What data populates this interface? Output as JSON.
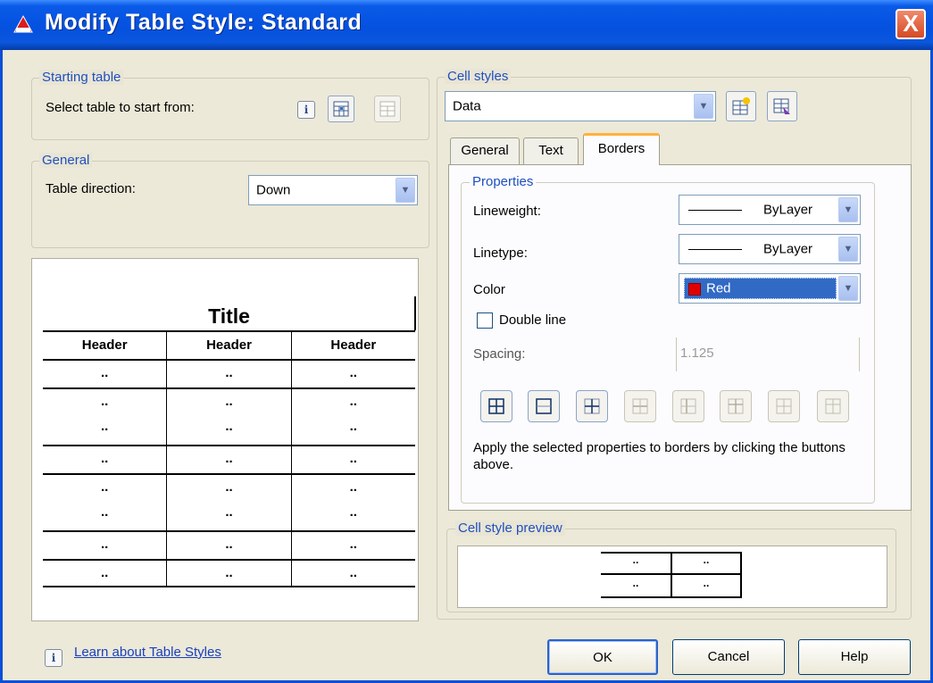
{
  "window": {
    "title": "Modify Table Style: Standard",
    "close_label": "X"
  },
  "starting_table": {
    "legend": "Starting table",
    "label": "Select table to start from:"
  },
  "general": {
    "legend": "General",
    "direction_label": "Table direction:",
    "direction_value": "Down"
  },
  "preview_table": {
    "title": "Title",
    "headers": [
      "Header",
      "Header",
      "Header"
    ],
    "rows": [
      [
        "..",
        "..",
        ".."
      ],
      [
        "..",
        "..",
        ".."
      ],
      [
        "..",
        "..",
        ".."
      ],
      [
        "..",
        "..",
        ".."
      ],
      [
        "..",
        "..",
        ".."
      ],
      [
        "..",
        "..",
        ".."
      ],
      [
        "..",
        "..",
        ".."
      ],
      [
        "..",
        "..",
        ".."
      ]
    ]
  },
  "cell_styles": {
    "legend": "Cell styles",
    "value": "Data"
  },
  "tabs": [
    "General",
    "Text",
    "Borders"
  ],
  "properties": {
    "legend": "Properties",
    "lineweight_label": "Lineweight:",
    "lineweight_value": "ByLayer",
    "linetype_label": "Linetype:",
    "linetype_value": "ByLayer",
    "color_label": "Color",
    "color_value": "Red",
    "color_swatch": "#e00000",
    "double_line_label": "Double line",
    "spacing_label": "Spacing:",
    "spacing_value": "1.125",
    "note": "Apply the selected properties to borders by clicking the buttons above."
  },
  "border_buttons": [
    "all-borders-icon",
    "outside-borders-icon",
    "inside-borders-icon",
    "inside-horizontal-icon",
    "inside-vertical-icon",
    "no-border-icon",
    "bottom-border-icon",
    "left-border-icon"
  ],
  "cell_style_preview": {
    "legend": "Cell style preview",
    "cells": [
      "..",
      "..",
      "..",
      ".."
    ]
  },
  "footer": {
    "help_link": "Learn about Table Styles",
    "ok": "OK",
    "cancel": "Cancel",
    "help": "Help"
  }
}
